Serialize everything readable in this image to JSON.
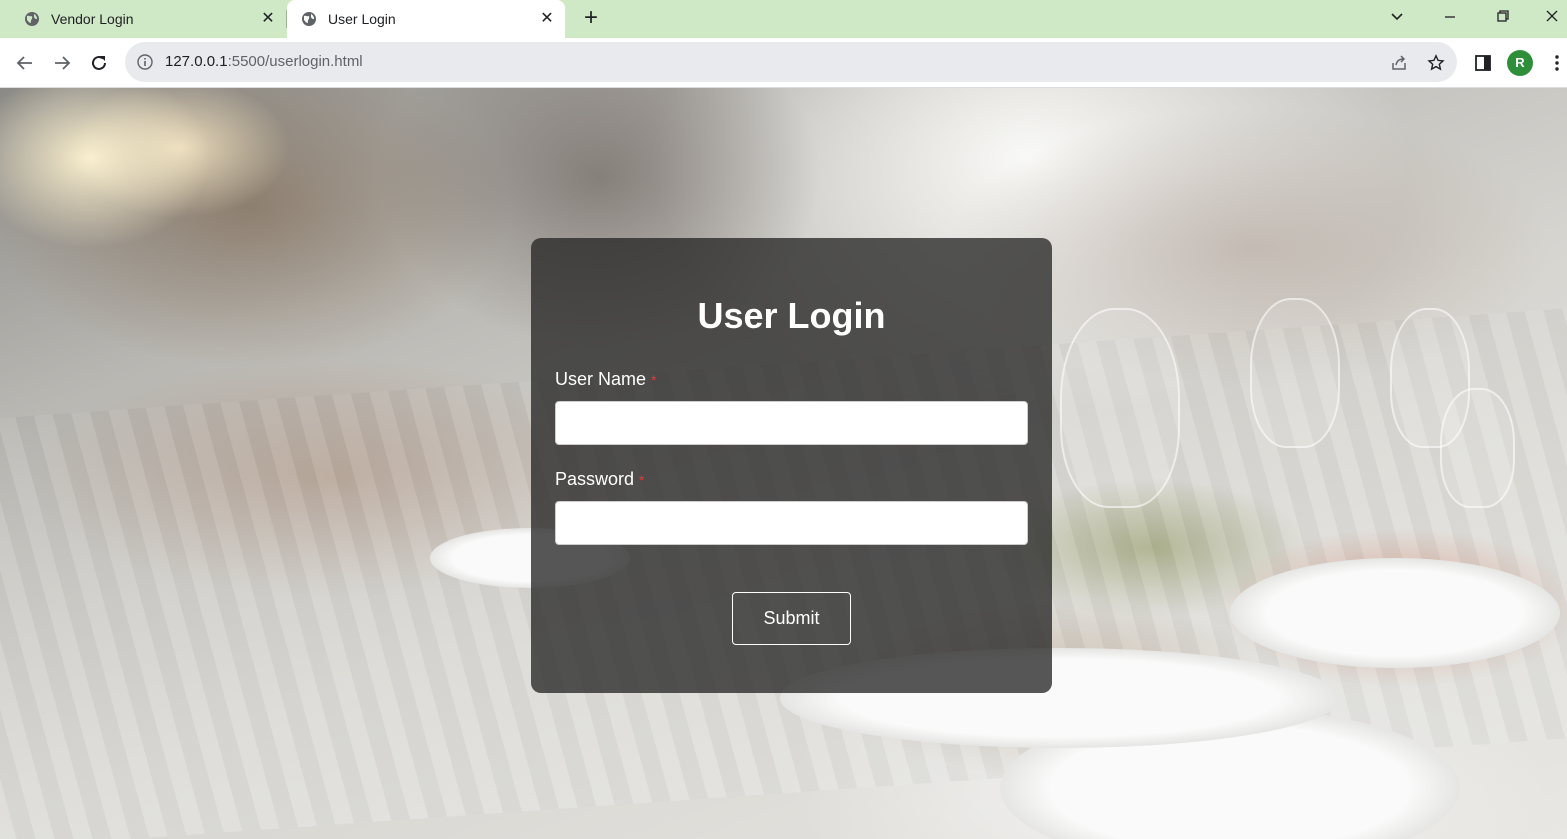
{
  "browser": {
    "tabs": [
      {
        "title": "Vendor Login",
        "active": false
      },
      {
        "title": "User Login",
        "active": true
      }
    ],
    "address": {
      "host": "127.0.0.1",
      "path": ":5500/userlogin.html"
    },
    "profile_initial": "R",
    "colors": {
      "tabstrip": "#cfe8c6",
      "profile": "#2f8e3a"
    }
  },
  "login": {
    "title": "User Login",
    "username_label": "User Name",
    "password_label": "Password",
    "required_marker": "*",
    "submit_label": "Submit"
  }
}
